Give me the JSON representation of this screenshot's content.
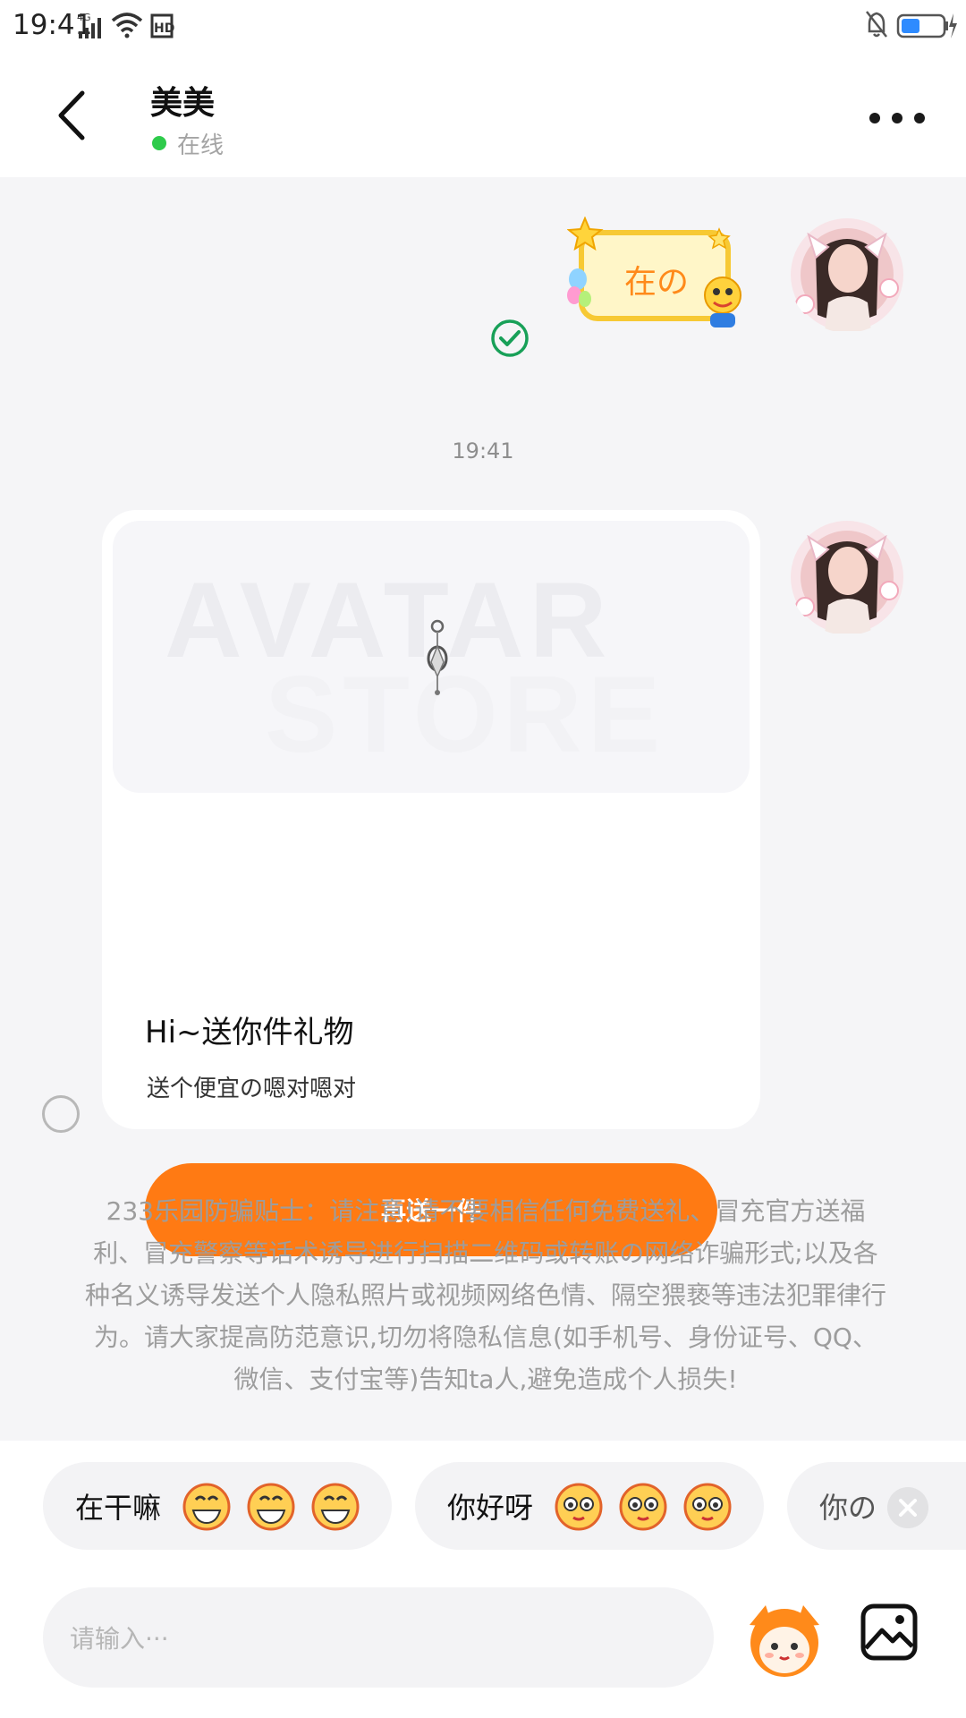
{
  "status_bar": {
    "time": "19:41",
    "network": "4G",
    "hd": "HD"
  },
  "header": {
    "contact_name": "美美",
    "status": "在线"
  },
  "chat": {
    "sticker_text": "在の",
    "timestamp": "19:41",
    "gift_card": {
      "watermark_line1": "AVATAR",
      "watermark_line2": "STORE",
      "title": "Hi~送你件礼物",
      "subtitle": "送个便宜の嗯对嗯对",
      "button_label": "再送一件"
    },
    "notice": "233乐园防骗贴士：请注意!请不要相信任何免费送礼、冒充官方送福利、冒充警察等话术诱导进行扫描二维码或转账の网络诈骗形式;以及各种名义诱导发送个人隐私照片或视频网络色情、隔空猥亵等违法犯罪律行为。请大家提高防范意识,切勿将隐私信息(如手机号、身份证号、QQ、微信、支付宝等)告知ta人,避免造成个人损失!"
  },
  "quick_replies": [
    {
      "text": "在干嘛"
    },
    {
      "text": "你好呀"
    },
    {
      "text": "你の"
    }
  ],
  "input": {
    "placeholder": "请输入···",
    "value": ""
  },
  "colors": {
    "accent": "#ff7a13",
    "online": "#2ecb4b",
    "check": "#18a058",
    "background": "#f5f5f7"
  },
  "icons": [
    "back-arrow-icon",
    "more-dots-icon",
    "read-check-icon",
    "close-icon",
    "mascot-emoji-icon",
    "image-icon"
  ]
}
